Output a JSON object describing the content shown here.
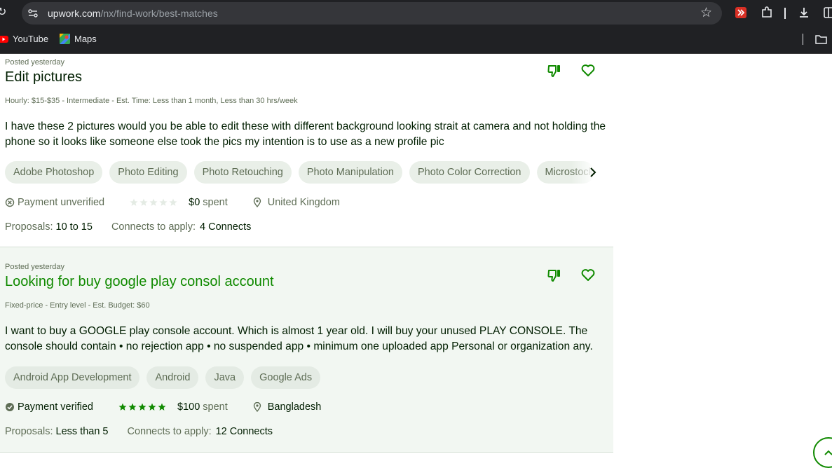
{
  "browser": {
    "url_domain": "upwork.com",
    "url_path": "/nx/find-work/best-matches",
    "bookmarks": [
      {
        "label": "YouTube",
        "icon": "youtube-icon"
      },
      {
        "label": "Maps",
        "icon": "maps-icon"
      }
    ]
  },
  "colors": {
    "brand_green": "#108a00",
    "text": "#001e00",
    "muted": "#5e6d55"
  },
  "jobs": [
    {
      "posted": "Posted yesterday",
      "title": "Edit pictures",
      "meta": "Hourly: $15-$35 - Intermediate - Est. Time: Less than 1 month, Less than 30 hrs/week",
      "description": "I have these 2 pictures would you be able to edit these with different background looking strait at camera and not holding the phone so it looks like someone else took the pics my intention is to use as a new profile pic",
      "skills": [
        "Adobe Photoshop",
        "Photo Editing",
        "Photo Retouching",
        "Photo Manipulation",
        "Photo Color Correction",
        "Microstock"
      ],
      "payment": "Payment unverified",
      "rating": 0,
      "spent_amount": "$0",
      "spent_label": "spent",
      "location": "United Kingdom",
      "proposals_label": "Proposals:",
      "proposals_value": "10 to 15",
      "connects_label": "Connects to apply:",
      "connects_value": "4 Connects"
    },
    {
      "posted": "Posted yesterday",
      "title": "Looking for buy google play consol account",
      "meta": "Fixed-price - Entry level - Est. Budget: $60",
      "description": "I want to buy a GOOGLE play console account. Which is almost 1 year old. I will buy your unused PLAY CONSOLE. The console should contain • no rejection app • no suspended app • minimum one uploaded app Personal or organization any.",
      "skills": [
        "Android App Development",
        "Android",
        "Java",
        "Google Ads"
      ],
      "payment": "Payment verified",
      "rating": 5,
      "spent_amount": "$100",
      "spent_label": "spent",
      "location": "Bangladesh",
      "proposals_label": "Proposals:",
      "proposals_value": "Less than 5",
      "connects_label": "Connects to apply:",
      "connects_value": "12 Connects"
    }
  ]
}
